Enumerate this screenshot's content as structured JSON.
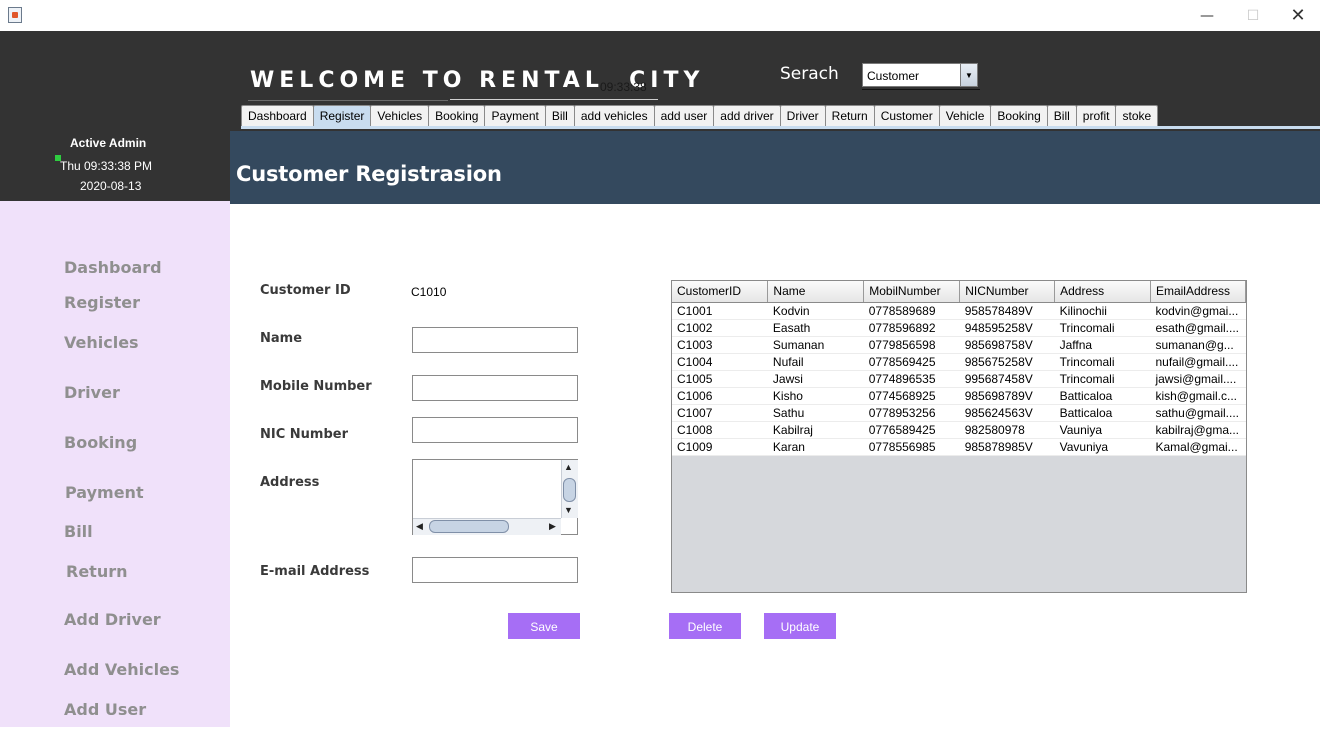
{
  "window": {
    "minimize_icon": "minimize-icon",
    "restore_icon": "restore-icon",
    "close_icon": "close-icon"
  },
  "header": {
    "welcome": "WELCOME TO RENTAL  CITY",
    "overlap_time": "09:33:38",
    "search_label": "Serach",
    "search_value": "Customer",
    "tabs": [
      "Dashboard",
      "Register",
      "Vehicles",
      "Booking",
      "Payment",
      "Bill",
      "add vehicles",
      "add user",
      "add driver",
      "Driver",
      "Return",
      "Customer",
      "Vehicle",
      "Booking",
      "Bill",
      "profit",
      "stoke"
    ],
    "active_tab": "Register"
  },
  "admin": {
    "title": "Active Admin",
    "time": "Thu 09:33:38 PM",
    "date": "2020-08-13"
  },
  "banner": {
    "title": "Customer Registrasion"
  },
  "sidebar": {
    "items": [
      "Dashboard",
      "Register",
      "Vehicles",
      "Driver",
      "Booking",
      "Payment",
      "Bill",
      "Return",
      "Add Driver",
      "Add Vehicles",
      "Add User"
    ]
  },
  "form": {
    "customer_id_label": "Customer ID",
    "customer_id_value": "C1010",
    "name_label": "Name",
    "mobile_label": "Mobile Number",
    "nic_label": "NIC Number",
    "address_label": "Address",
    "email_label": "E-mail Address",
    "save": "Save",
    "delete": "Delete",
    "update": "Update"
  },
  "table": {
    "columns": [
      "CustomerID",
      "Name",
      "MobilNumber",
      "NICNumber",
      "Address",
      "EmailAddress"
    ],
    "rows": [
      [
        "C1001",
        "Kodvin",
        "0778589689",
        "958578489V",
        "Kilinochii",
        "kodvin@gmai..."
      ],
      [
        "C1002",
        "Easath",
        "0778596892",
        "948595258V",
        "Trincomali",
        "esath@gmail...."
      ],
      [
        "C1003",
        "Sumanan",
        "0779856598",
        "985698758V",
        "Jaffna",
        "sumanan@g..."
      ],
      [
        "C1004",
        "Nufail",
        "0778569425",
        "985675258V",
        "Trincomali",
        "nufail@gmail...."
      ],
      [
        "C1005",
        "Jawsi",
        "0774896535",
        "995687458V",
        "Trincomali",
        "jawsi@gmail...."
      ],
      [
        "C1006",
        "Kisho",
        "0774568925",
        "985698789V",
        "Batticaloa",
        "kish@gmail.c..."
      ],
      [
        "C1007",
        "Sathu",
        "0778953256",
        "985624563V",
        "Batticaloa",
        "sathu@gmail...."
      ],
      [
        "C1008",
        "Kabilraj",
        "0776589425",
        "982580978",
        "Vauniya",
        "kabilraj@gma..."
      ],
      [
        "C1009",
        "Karan",
        "0778556985",
        "985878985V",
        "Vavuniya",
        "Kamal@gmai..."
      ]
    ]
  }
}
